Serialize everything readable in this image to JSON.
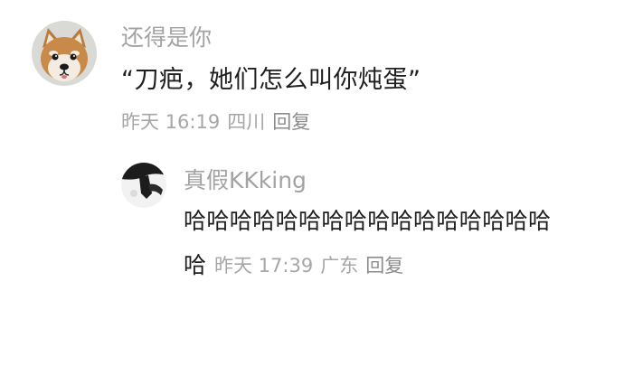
{
  "comment": {
    "username": "还得是你",
    "content": "“刀疤，她们怎么叫你炖蛋”",
    "time": "昨天 16:19",
    "location": "四川",
    "reply_label": "回复",
    "avatar_icon": "shiba-dog-avatar-icon"
  },
  "reply": {
    "username": "真假KKking",
    "content_line1": "哈哈哈哈哈哈哈哈哈哈哈哈哈哈哈哈",
    "content_line2": "哈",
    "time": "昨天 17:39",
    "location": "广东",
    "reply_label": "回复",
    "avatar_icon": "bw-avatar-icon"
  },
  "colors": {
    "username": "#a3a3a3",
    "content": "#1f1f1f",
    "meta": "#a6a6a6"
  }
}
